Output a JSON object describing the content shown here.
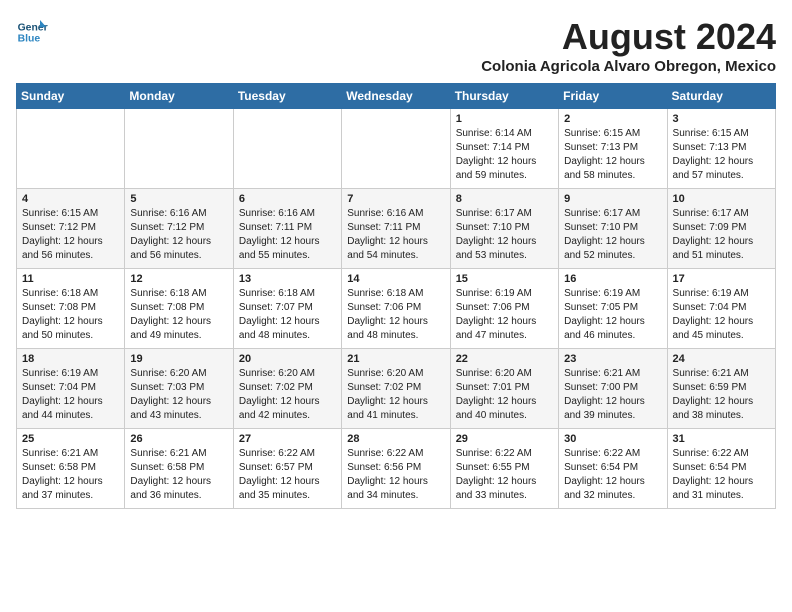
{
  "header": {
    "logo_line1": "General",
    "logo_line2": "Blue",
    "month_year": "August 2024",
    "location": "Colonia Agricola Alvaro Obregon, Mexico"
  },
  "days_of_week": [
    "Sunday",
    "Monday",
    "Tuesday",
    "Wednesday",
    "Thursday",
    "Friday",
    "Saturday"
  ],
  "weeks": [
    [
      {
        "day": "",
        "text": ""
      },
      {
        "day": "",
        "text": ""
      },
      {
        "day": "",
        "text": ""
      },
      {
        "day": "",
        "text": ""
      },
      {
        "day": "1",
        "text": "Sunrise: 6:14 AM\nSunset: 7:14 PM\nDaylight: 12 hours\nand 59 minutes."
      },
      {
        "day": "2",
        "text": "Sunrise: 6:15 AM\nSunset: 7:13 PM\nDaylight: 12 hours\nand 58 minutes."
      },
      {
        "day": "3",
        "text": "Sunrise: 6:15 AM\nSunset: 7:13 PM\nDaylight: 12 hours\nand 57 minutes."
      }
    ],
    [
      {
        "day": "4",
        "text": "Sunrise: 6:15 AM\nSunset: 7:12 PM\nDaylight: 12 hours\nand 56 minutes."
      },
      {
        "day": "5",
        "text": "Sunrise: 6:16 AM\nSunset: 7:12 PM\nDaylight: 12 hours\nand 56 minutes."
      },
      {
        "day": "6",
        "text": "Sunrise: 6:16 AM\nSunset: 7:11 PM\nDaylight: 12 hours\nand 55 minutes."
      },
      {
        "day": "7",
        "text": "Sunrise: 6:16 AM\nSunset: 7:11 PM\nDaylight: 12 hours\nand 54 minutes."
      },
      {
        "day": "8",
        "text": "Sunrise: 6:17 AM\nSunset: 7:10 PM\nDaylight: 12 hours\nand 53 minutes."
      },
      {
        "day": "9",
        "text": "Sunrise: 6:17 AM\nSunset: 7:10 PM\nDaylight: 12 hours\nand 52 minutes."
      },
      {
        "day": "10",
        "text": "Sunrise: 6:17 AM\nSunset: 7:09 PM\nDaylight: 12 hours\nand 51 minutes."
      }
    ],
    [
      {
        "day": "11",
        "text": "Sunrise: 6:18 AM\nSunset: 7:08 PM\nDaylight: 12 hours\nand 50 minutes."
      },
      {
        "day": "12",
        "text": "Sunrise: 6:18 AM\nSunset: 7:08 PM\nDaylight: 12 hours\nand 49 minutes."
      },
      {
        "day": "13",
        "text": "Sunrise: 6:18 AM\nSunset: 7:07 PM\nDaylight: 12 hours\nand 48 minutes."
      },
      {
        "day": "14",
        "text": "Sunrise: 6:18 AM\nSunset: 7:06 PM\nDaylight: 12 hours\nand 48 minutes."
      },
      {
        "day": "15",
        "text": "Sunrise: 6:19 AM\nSunset: 7:06 PM\nDaylight: 12 hours\nand 47 minutes."
      },
      {
        "day": "16",
        "text": "Sunrise: 6:19 AM\nSunset: 7:05 PM\nDaylight: 12 hours\nand 46 minutes."
      },
      {
        "day": "17",
        "text": "Sunrise: 6:19 AM\nSunset: 7:04 PM\nDaylight: 12 hours\nand 45 minutes."
      }
    ],
    [
      {
        "day": "18",
        "text": "Sunrise: 6:19 AM\nSunset: 7:04 PM\nDaylight: 12 hours\nand 44 minutes."
      },
      {
        "day": "19",
        "text": "Sunrise: 6:20 AM\nSunset: 7:03 PM\nDaylight: 12 hours\nand 43 minutes."
      },
      {
        "day": "20",
        "text": "Sunrise: 6:20 AM\nSunset: 7:02 PM\nDaylight: 12 hours\nand 42 minutes."
      },
      {
        "day": "21",
        "text": "Sunrise: 6:20 AM\nSunset: 7:02 PM\nDaylight: 12 hours\nand 41 minutes."
      },
      {
        "day": "22",
        "text": "Sunrise: 6:20 AM\nSunset: 7:01 PM\nDaylight: 12 hours\nand 40 minutes."
      },
      {
        "day": "23",
        "text": "Sunrise: 6:21 AM\nSunset: 7:00 PM\nDaylight: 12 hours\nand 39 minutes."
      },
      {
        "day": "24",
        "text": "Sunrise: 6:21 AM\nSunset: 6:59 PM\nDaylight: 12 hours\nand 38 minutes."
      }
    ],
    [
      {
        "day": "25",
        "text": "Sunrise: 6:21 AM\nSunset: 6:58 PM\nDaylight: 12 hours\nand 37 minutes."
      },
      {
        "day": "26",
        "text": "Sunrise: 6:21 AM\nSunset: 6:58 PM\nDaylight: 12 hours\nand 36 minutes."
      },
      {
        "day": "27",
        "text": "Sunrise: 6:22 AM\nSunset: 6:57 PM\nDaylight: 12 hours\nand 35 minutes."
      },
      {
        "day": "28",
        "text": "Sunrise: 6:22 AM\nSunset: 6:56 PM\nDaylight: 12 hours\nand 34 minutes."
      },
      {
        "day": "29",
        "text": "Sunrise: 6:22 AM\nSunset: 6:55 PM\nDaylight: 12 hours\nand 33 minutes."
      },
      {
        "day": "30",
        "text": "Sunrise: 6:22 AM\nSunset: 6:54 PM\nDaylight: 12 hours\nand 32 minutes."
      },
      {
        "day": "31",
        "text": "Sunrise: 6:22 AM\nSunset: 6:54 PM\nDaylight: 12 hours\nand 31 minutes."
      }
    ]
  ]
}
